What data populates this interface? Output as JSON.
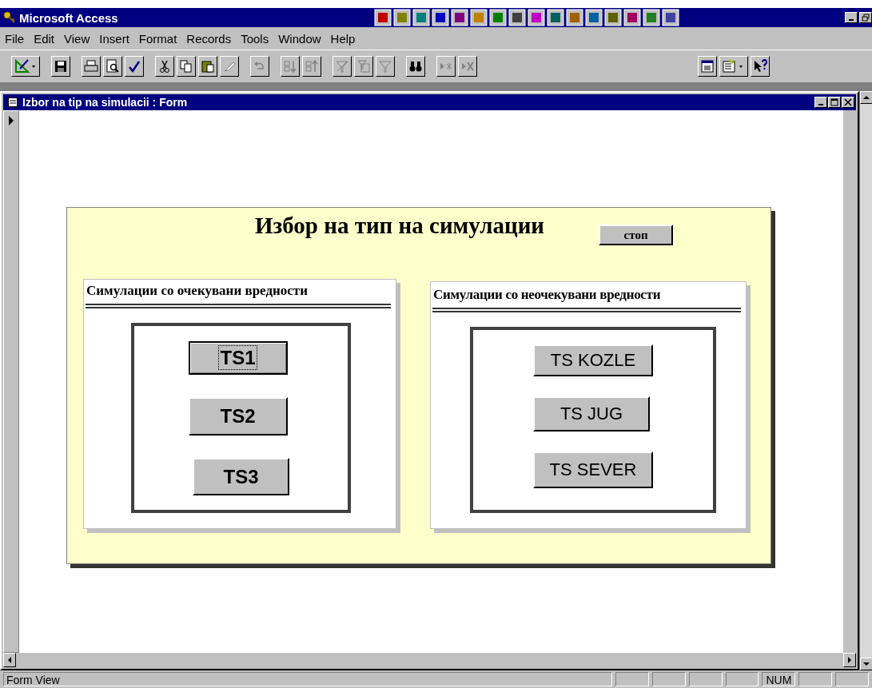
{
  "app": {
    "title": "Microsoft Access"
  },
  "menu": [
    {
      "label": "File"
    },
    {
      "label": "Edit"
    },
    {
      "label": "View"
    },
    {
      "label": "Insert"
    },
    {
      "label": "Format"
    },
    {
      "label": "Records"
    },
    {
      "label": "Tools"
    },
    {
      "label": "Window"
    },
    {
      "label": "Help"
    }
  ],
  "form_window": {
    "title": "Izbor na tip na simulacii : Form"
  },
  "form": {
    "title": "Избор на тип на симулации",
    "stop_button": "стоп",
    "groups": [
      {
        "heading": "Симулации со очекувани вредности",
        "kind": "bold",
        "buttons": [
          {
            "label": "TS1",
            "focused": true
          },
          {
            "label": "TS2",
            "focused": false
          },
          {
            "label": "TS3",
            "focused": false
          }
        ]
      },
      {
        "heading": "Симулации со неочекувани вредности",
        "kind": "normal",
        "buttons": [
          {
            "label": "TS KOZLE",
            "focused": false
          },
          {
            "label": "TS JUG",
            "focused": false
          },
          {
            "label": "TS SEVER",
            "focused": false
          }
        ]
      }
    ]
  },
  "status_bar": {
    "text": "Form View",
    "indicators": [
      "NUM"
    ]
  }
}
